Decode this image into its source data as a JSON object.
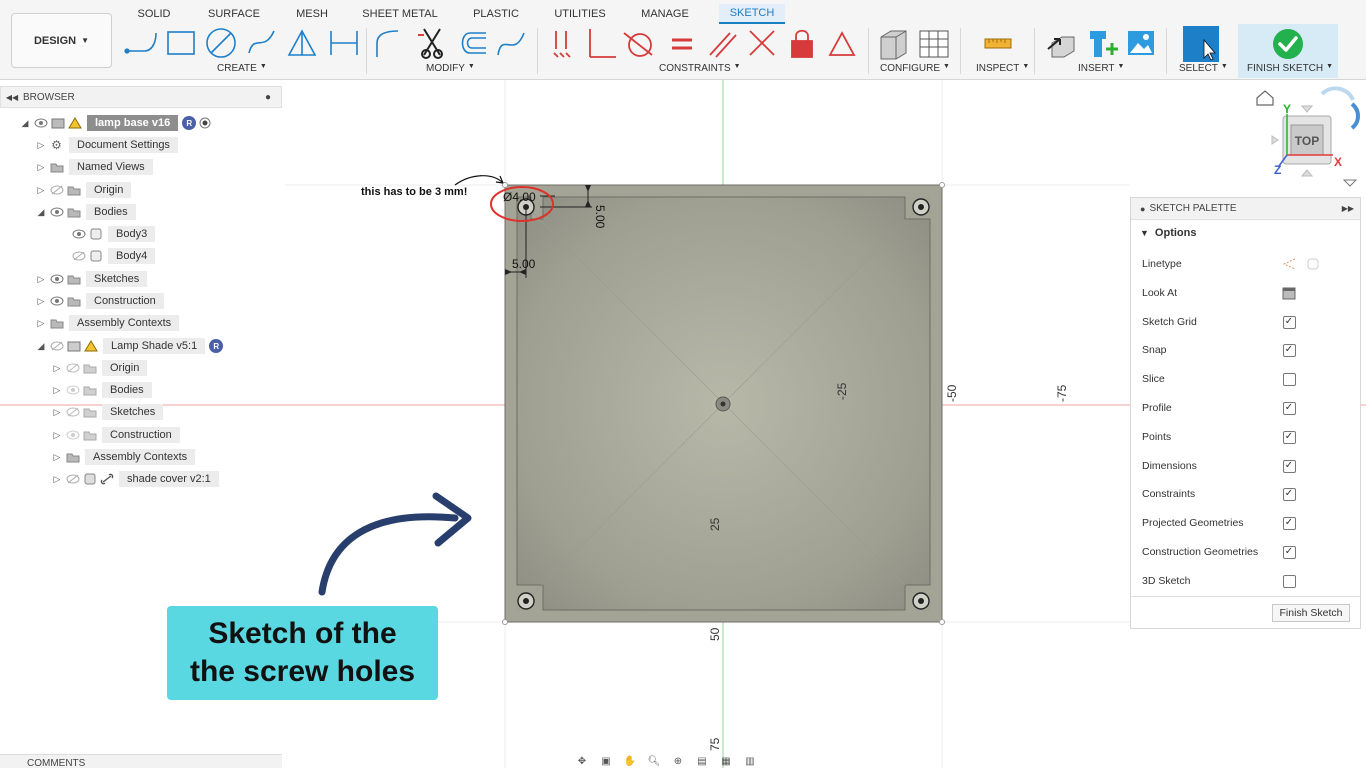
{
  "toolbar": {
    "design_label": "DESIGN",
    "tabs": [
      "SOLID",
      "SURFACE",
      "MESH",
      "SHEET METAL",
      "PLASTIC",
      "UTILITIES",
      "MANAGE",
      "SKETCH"
    ],
    "groups": {
      "create": "CREATE",
      "modify": "MODIFY",
      "constraints": "CONSTRAINTS",
      "configure": "CONFIGURE",
      "inspect": "INSPECT",
      "insert": "INSERT",
      "select": "SELECT",
      "finish": "FINISH SKETCH"
    },
    "accent": "#1a7ec4"
  },
  "browser": {
    "title": "BROWSER",
    "items": [
      {
        "label": "lamp base v16",
        "badge": "R"
      },
      {
        "label": "Document Settings"
      },
      {
        "label": "Named Views"
      },
      {
        "label": "Origin"
      },
      {
        "label": "Bodies"
      },
      {
        "label": "Body3"
      },
      {
        "label": "Body4"
      },
      {
        "label": "Sketches"
      },
      {
        "label": "Construction"
      },
      {
        "label": "Assembly Contexts"
      },
      {
        "label": "Lamp Shade v5:1",
        "badge": "R"
      },
      {
        "label": "Origin"
      },
      {
        "label": "Bodies"
      },
      {
        "label": "Sketches"
      },
      {
        "label": "Construction"
      },
      {
        "label": "Assembly Contexts"
      },
      {
        "label": "shade cover v2:1"
      }
    ]
  },
  "canvas": {
    "note": "this has to be 3 mm!",
    "dims": {
      "diameter": "Ø4.00",
      "offset_x": "5.00",
      "offset_y": "5.00"
    },
    "axis_labels": {
      "v_neg25": "-25",
      "v_neg50": "-50",
      "v_neg75": "-75",
      "h_25": "25",
      "h_50": "50",
      "h_75": "75"
    },
    "callout": "Sketch of the\nthe screw holes",
    "callout_color": "#5ad8e2"
  },
  "viewcube": {
    "face": "TOP",
    "y": "Y",
    "x": "X",
    "z": "Z"
  },
  "palette": {
    "title": "SKETCH PALETTE",
    "section": "Options",
    "options": [
      {
        "label": "Linetype",
        "control": "linetype-icons"
      },
      {
        "label": "Look At",
        "control": "look-at-icon"
      },
      {
        "label": "Sketch Grid",
        "control": "checkbox",
        "checked": true
      },
      {
        "label": "Snap",
        "control": "checkbox",
        "checked": true
      },
      {
        "label": "Slice",
        "control": "checkbox",
        "checked": false
      },
      {
        "label": "Profile",
        "control": "checkbox",
        "checked": true
      },
      {
        "label": "Points",
        "control": "checkbox",
        "checked": true
      },
      {
        "label": "Dimensions",
        "control": "checkbox",
        "checked": true
      },
      {
        "label": "Constraints",
        "control": "checkbox",
        "checked": true
      },
      {
        "label": "Projected Geometries",
        "control": "checkbox",
        "checked": true
      },
      {
        "label": "Construction Geometries",
        "control": "checkbox",
        "checked": true
      },
      {
        "label": "3D Sketch",
        "control": "checkbox",
        "checked": false
      }
    ],
    "finish_label": "Finish Sketch"
  },
  "comments": {
    "title": "COMMENTS"
  }
}
